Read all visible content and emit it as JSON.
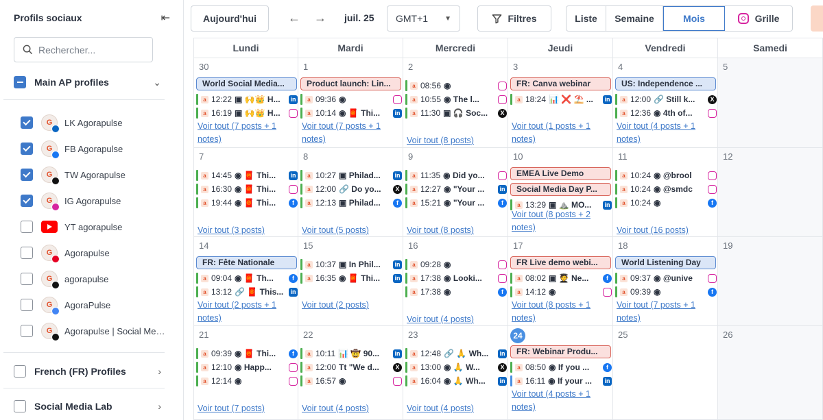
{
  "sidebar": {
    "title": "Profils sociaux",
    "search_placeholder": "Rechercher...",
    "groups": [
      {
        "label": "Main AP profiles",
        "state": "partial"
      },
      {
        "label": "French (FR) Profiles",
        "state": "unchecked"
      },
      {
        "label": "Social Media Lab",
        "state": "unchecked"
      }
    ],
    "profiles": [
      {
        "name": "LK Agorapulse",
        "checked": true,
        "network": "linkedin"
      },
      {
        "name": "FB Agorapulse",
        "checked": true,
        "network": "facebook"
      },
      {
        "name": "TW Agorapulse",
        "checked": true,
        "network": "twitter"
      },
      {
        "name": "IG Agorapulse",
        "checked": true,
        "network": "instagram"
      },
      {
        "name": "YT agorapulse",
        "checked": false,
        "network": "youtube"
      },
      {
        "name": "Agorapulse",
        "checked": false,
        "network": "pinterest"
      },
      {
        "name": "agorapulse",
        "checked": false,
        "network": "tiktok"
      },
      {
        "name": "AgoraPulse",
        "checked": false,
        "network": "google-business"
      },
      {
        "name": "Agorapulse | Social Media Management",
        "checked": false,
        "network": "threads"
      }
    ]
  },
  "toolbar": {
    "today_label": "Aujourd'hui",
    "month_label": "juil. 25",
    "timezone": "GMT+1",
    "filters_label": "Filtres",
    "views": [
      "Liste",
      "Semaine",
      "Mois",
      "Grille"
    ],
    "active_view": "Mois"
  },
  "calendar": {
    "weekdays": [
      "Lundi",
      "Mardi",
      "Mercredi",
      "Jeudi",
      "Vendredi",
      "Samedi"
    ],
    "today": "24",
    "weeks": [
      [
        {
          "day": "30",
          "events": [
            {
              "label": "World Social Media...",
              "kind": "blue"
            }
          ],
          "posts": [
            {
              "time": "12:22",
              "text": "▣ 🙌👑 H...",
              "net": "li"
            },
            {
              "time": "16:19",
              "text": "▣ 🙌👑 H...",
              "net": "ig"
            }
          ],
          "see_all": "Voir tout (7 posts + 1 notes)"
        },
        {
          "day": "1",
          "events": [
            {
              "label": "Product launch: Lin...",
              "kind": "red"
            }
          ],
          "posts": [
            {
              "time": "09:36",
              "text": "◉",
              "net": "ig"
            },
            {
              "time": "10:14",
              "text": "◉ 🧧 Thi...",
              "net": "li"
            }
          ],
          "see_all": "Voir tout (7 posts + 1 notes)"
        },
        {
          "day": "2",
          "events": [],
          "posts": [
            {
              "time": "08:56",
              "text": "◉",
              "net": "ig"
            },
            {
              "time": "10:55",
              "text": "◉ The l...",
              "net": "ig"
            },
            {
              "time": "11:30",
              "text": "▣ 🎧 Soc...",
              "net": "tw"
            }
          ],
          "see_all": "Voir tout (8 posts)"
        },
        {
          "day": "3",
          "events": [
            {
              "label": "FR: Canva webinar",
              "kind": "red"
            }
          ],
          "posts": [
            {
              "time": "18:24",
              "text": "📊 ❌ ⛱️ ...",
              "net": "li"
            }
          ],
          "see_all": "Voir tout (1 posts + 1 notes)"
        },
        {
          "day": "4",
          "events": [
            {
              "label": "US: Independence ...",
              "kind": "blue"
            }
          ],
          "posts": [
            {
              "time": "12:00",
              "text": "🔗 Still k...",
              "net": "tw"
            },
            {
              "time": "12:36",
              "text": "◉ 4th of...",
              "net": "ig"
            }
          ],
          "see_all": "Voir tout (4 posts + 1 notes)"
        },
        {
          "day": "5",
          "events": [],
          "posts": [],
          "see_all": ""
        }
      ],
      [
        {
          "day": "7",
          "events": [],
          "posts": [
            {
              "time": "14:45",
              "text": "◉ 🧧 Thi...",
              "net": "li"
            },
            {
              "time": "16:30",
              "text": "◉ 🧧 Thi...",
              "net": "ig"
            },
            {
              "time": "19:44",
              "text": "◉ 🧧 Thi...",
              "net": "fb"
            }
          ],
          "see_all": "Voir tout (3 posts)"
        },
        {
          "day": "8",
          "events": [],
          "posts": [
            {
              "time": "10:27",
              "text": "▣ Philad...",
              "net": "li"
            },
            {
              "time": "12:00",
              "text": "🔗 Do yo...",
              "net": "tw"
            },
            {
              "time": "12:13",
              "text": "▣ Philad...",
              "net": "fb"
            }
          ],
          "see_all": "Voir tout (5 posts)"
        },
        {
          "day": "9",
          "events": [],
          "posts": [
            {
              "time": "11:35",
              "text": "◉ Did yo...",
              "net": "ig"
            },
            {
              "time": "12:27",
              "text": "◉ \"Your ...",
              "net": "li"
            },
            {
              "time": "15:21",
              "text": "◉ \"Your ...",
              "net": "fb"
            }
          ],
          "see_all": "Voir tout (8 posts)"
        },
        {
          "day": "10",
          "events": [
            {
              "label": "EMEA Live Demo",
              "kind": "red"
            },
            {
              "label": "Social Media Day P...",
              "kind": "red"
            }
          ],
          "posts": [
            {
              "time": "13:29",
              "text": "▣ ⛰️ MO...",
              "net": "li"
            }
          ],
          "see_all": "Voir tout (8 posts + 2 notes)"
        },
        {
          "day": "11",
          "events": [],
          "posts": [
            {
              "time": "10:24",
              "text": "◉ @brool",
              "net": "ig"
            },
            {
              "time": "10:24",
              "text": "◉ @smdc",
              "net": "ig"
            },
            {
              "time": "10:24",
              "text": "◉",
              "net": "fb"
            }
          ],
          "see_all": "Voir tout (16 posts)"
        },
        {
          "day": "12",
          "events": [],
          "posts": [],
          "see_all": ""
        }
      ],
      [
        {
          "day": "14",
          "events": [
            {
              "label": "FR: Fête Nationale",
              "kind": "blue"
            }
          ],
          "posts": [
            {
              "time": "09:04",
              "text": "◉ 🧧 Th...",
              "net": "fb"
            },
            {
              "time": "13:12",
              "text": "🔗 🧧 This...",
              "net": "li"
            }
          ],
          "see_all": "Voir tout (2 posts + 1 notes)"
        },
        {
          "day": "15",
          "events": [],
          "posts": [
            {
              "time": "10:37",
              "text": "▣ In Phil...",
              "net": "li"
            },
            {
              "time": "16:35",
              "text": "◉ 🧧 Thi...",
              "net": "li"
            }
          ],
          "see_all": "Voir tout (2 posts)"
        },
        {
          "day": "16",
          "events": [],
          "posts": [
            {
              "time": "09:28",
              "text": "◉",
              "net": "ig"
            },
            {
              "time": "17:38",
              "text": "◉ Looki...",
              "net": "ig"
            },
            {
              "time": "17:38",
              "text": "◉",
              "net": "fb"
            }
          ],
          "see_all": "Voir tout (4 posts)"
        },
        {
          "day": "17",
          "events": [
            {
              "label": "FR Live demo webi...",
              "kind": "red"
            }
          ],
          "posts": [
            {
              "time": "08:02",
              "text": "▣ 🧑‍🎓 Ne...",
              "net": "fb"
            },
            {
              "time": "14:12",
              "text": "◉",
              "net": "ig"
            }
          ],
          "see_all": "Voir tout (8 posts + 1 notes)"
        },
        {
          "day": "18",
          "events": [
            {
              "label": "World Listening Day",
              "kind": "blue"
            }
          ],
          "posts": [
            {
              "time": "09:37",
              "text": "◉ @unive",
              "net": "ig"
            },
            {
              "time": "09:39",
              "text": "◉",
              "net": "fb"
            }
          ],
          "see_all": "Voir tout (7 posts + 1 notes)"
        },
        {
          "day": "19",
          "events": [],
          "posts": [],
          "see_all": ""
        }
      ],
      [
        {
          "day": "21",
          "events": [],
          "posts": [
            {
              "time": "09:39",
              "text": "◉ 🧧 Thi...",
              "net": "fb"
            },
            {
              "time": "12:10",
              "text": "◉ Happ...",
              "net": "ig"
            },
            {
              "time": "12:14",
              "text": "◉",
              "net": "ig"
            }
          ],
          "see_all": "Voir tout (7 posts)"
        },
        {
          "day": "22",
          "events": [],
          "posts": [
            {
              "time": "10:11",
              "text": "📊 🤠 90...",
              "net": "li"
            },
            {
              "time": "12:00",
              "text": "Tt \"We d...",
              "net": "tw"
            },
            {
              "time": "16:57",
              "text": "◉",
              "net": "ig"
            }
          ],
          "see_all": "Voir tout (4 posts)"
        },
        {
          "day": "23",
          "events": [],
          "posts": [
            {
              "time": "12:48",
              "text": "🔗 🙏 Wh...",
              "net": "li"
            },
            {
              "time": "13:00",
              "text": "◉ 🙏 W...",
              "net": "tw"
            },
            {
              "time": "16:04",
              "text": "◉ 🙏 Wh...",
              "net": "li"
            }
          ],
          "see_all": "Voir tout (4 posts)"
        },
        {
          "day": "24",
          "events": [
            {
              "label": "FR: Webinar Produ...",
              "kind": "red"
            }
          ],
          "posts": [
            {
              "time": "08:50",
              "text": "◉ If you ...",
              "net": "fb"
            },
            {
              "time": "16:11",
              "text": "◉ If your ...",
              "net": "li",
              "bar": "blue"
            }
          ],
          "see_all": "Voir tout (4 posts + 1 notes)"
        },
        {
          "day": "25",
          "events": [],
          "posts": [],
          "see_all": ""
        },
        {
          "day": "26",
          "events": [],
          "posts": [],
          "see_all": ""
        }
      ]
    ]
  }
}
